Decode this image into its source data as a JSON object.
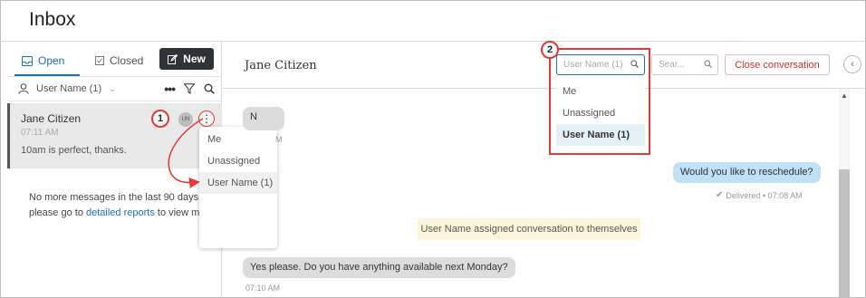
{
  "header": {
    "title": "Inbox"
  },
  "tabs": [
    {
      "label": "Open",
      "active": true,
      "icon": "inbox-icon"
    },
    {
      "label": "Closed",
      "active": false,
      "icon": "closed-checkbox-icon"
    }
  ],
  "new_button": {
    "label": "New",
    "icon": "edit-icon"
  },
  "filter": {
    "user_label": "User Name (1)"
  },
  "conversation": {
    "name": "Jane Citizen",
    "time": "07:11 AM",
    "snippet": "10am is perfect, thanks.",
    "avatar_initials": "UN"
  },
  "empty_message": {
    "before_link": "No more messages in the last 90 days, please go to ",
    "link_text": "detailed reports",
    "after_link": " to view more"
  },
  "assign_menu_left": {
    "items": [
      "Me",
      "Unassigned",
      "User Name (1)"
    ]
  },
  "chat": {
    "title": "Jane Citizen",
    "assign_placeholder": "User Name (1)",
    "search_placeholder": "Sear...",
    "close_label": "Close conversation",
    "assign_menu": {
      "items": [
        "Me",
        "Unassigned",
        "User Name (1)"
      ],
      "selected": "User Name (1)"
    },
    "messages": {
      "first_bubble": "N",
      "first_time": "M",
      "outgoing": "Would you like to reschedule?",
      "outgoing_status": "Delivered • 07:08 AM",
      "system_note": "User Name assigned conversation to themselves",
      "incoming": "Yes please. Do you have anything available next Monday?",
      "incoming_time": "07:10 AM"
    }
  },
  "callouts": {
    "one": "1",
    "two": "2"
  },
  "colors": {
    "accent": "#1f6fb3",
    "callout": "#e53935",
    "outgoing_bubble": "#bfe0f5",
    "note": "#fbf6d9"
  }
}
